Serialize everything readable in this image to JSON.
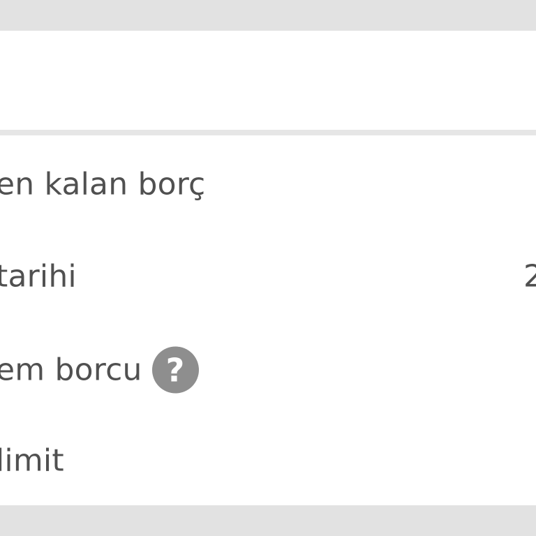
{
  "rows": [
    {
      "label": "en kalan borç",
      "value": ""
    },
    {
      "label": "tarihi",
      "value": "2"
    },
    {
      "label": "em borcu",
      "value": "",
      "help_icon": "?"
    },
    {
      "label": "limit",
      "value": ""
    }
  ],
  "icons": {
    "help": "help-question-circle-icon"
  },
  "colors": {
    "background": "#e2e2e2",
    "card": "#ffffff",
    "text": "#505050",
    "help_icon_bg": "#8e8e8e"
  }
}
